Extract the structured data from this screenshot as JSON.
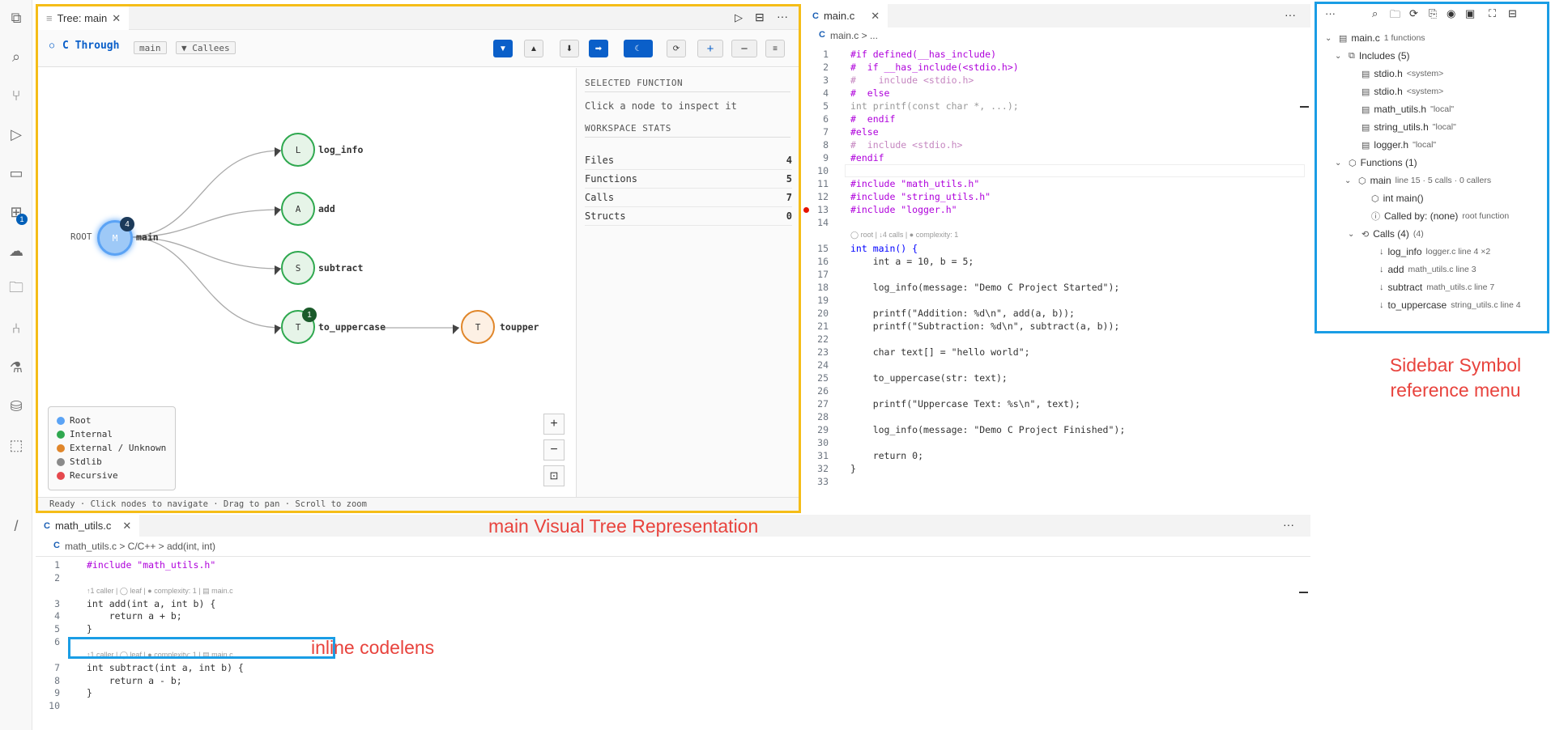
{
  "activity_icons": [
    "files-icon",
    "search-icon",
    "source-control-icon",
    "run-debug-icon",
    "remote-explorer-icon",
    "extensions-icon",
    "chat-icon",
    "folder-icon",
    "git-graph-icon",
    "testing-icon",
    "database-icon",
    "cube-icon",
    "slash-icon"
  ],
  "extensions_badge": "1",
  "tree_panel": {
    "tab_label": "Tree: main",
    "title": "C Through",
    "chip_main": "main",
    "chip_callees": "▼ Callees",
    "selected_header": "SELECTED FUNCTION",
    "selected_hint": "Click a node to inspect it",
    "stats_header": "WORKSPACE STATS",
    "stats": [
      {
        "label": "Files",
        "value": "4"
      },
      {
        "label": "Functions",
        "value": "5"
      },
      {
        "label": "Calls",
        "value": "7"
      },
      {
        "label": "Structs",
        "value": "0"
      }
    ],
    "root_label": "ROOT",
    "nodes": [
      {
        "letter": "M",
        "label": "main",
        "kind": "root",
        "badge": "4"
      },
      {
        "letter": "L",
        "label": "log_info",
        "kind": "internal"
      },
      {
        "letter": "A",
        "label": "add",
        "kind": "internal"
      },
      {
        "letter": "S",
        "label": "subtract",
        "kind": "internal"
      },
      {
        "letter": "T",
        "label": "to_uppercase",
        "kind": "internal",
        "badge": "1"
      },
      {
        "letter": "T",
        "label": "toupper",
        "kind": "external"
      }
    ],
    "legend": [
      {
        "label": "Root",
        "color": "#5ba3f5"
      },
      {
        "label": "Internal",
        "color": "#2fa84f"
      },
      {
        "label": "External / Unknown",
        "color": "#e0862a"
      },
      {
        "label": "Stdlib",
        "color": "#8a8a8a"
      },
      {
        "label": "Recursive",
        "color": "#e5484d"
      }
    ],
    "status": "Ready · Click nodes to navigate · Drag to pan · Scroll to zoom"
  },
  "main_editor": {
    "tab_label": "main.c",
    "breadcrumb": "main.c > ...",
    "codelens": "◯ root | ↓4 calls | ● complexity: 1",
    "lines": [
      {
        "n": "1",
        "t": "#if defined(__has_include)",
        "c": "pp"
      },
      {
        "n": "2",
        "t": "#  if __has_include(<stdio.h>)",
        "c": "pp"
      },
      {
        "n": "3",
        "t": "#    include <stdio.h>",
        "c": "cm"
      },
      {
        "n": "4",
        "t": "#  else",
        "c": "pp"
      },
      {
        "n": "5",
        "t": "int printf(const char *, ...);",
        "c": "gray"
      },
      {
        "n": "6",
        "t": "#  endif",
        "c": "pp"
      },
      {
        "n": "7",
        "t": "#else",
        "c": "pp"
      },
      {
        "n": "8",
        "t": "#  include <stdio.h>",
        "c": "cm"
      },
      {
        "n": "9",
        "t": "#endif",
        "c": "pp"
      },
      {
        "n": "10",
        "t": "",
        "c": ""
      },
      {
        "n": "11",
        "t": "#include \"math_utils.h\"",
        "c": "pp"
      },
      {
        "n": "12",
        "t": "#include \"string_utils.h\"",
        "c": "pp"
      },
      {
        "n": "13",
        "t": "#include \"logger.h\"",
        "c": "pp"
      },
      {
        "n": "14",
        "t": "",
        "c": ""
      },
      {
        "n": "15",
        "t": "int main() {",
        "c": "kw"
      },
      {
        "n": "16",
        "t": "    int a = 10, b = 5;",
        "c": ""
      },
      {
        "n": "17",
        "t": "",
        "c": ""
      },
      {
        "n": "18",
        "t": "    log_info(message: \"Demo C Project Started\");",
        "c": ""
      },
      {
        "n": "19",
        "t": "",
        "c": ""
      },
      {
        "n": "20",
        "t": "    printf(\"Addition: %d\\n\", add(a, b));",
        "c": ""
      },
      {
        "n": "21",
        "t": "    printf(\"Subtraction: %d\\n\", subtract(a, b));",
        "c": ""
      },
      {
        "n": "22",
        "t": "",
        "c": ""
      },
      {
        "n": "23",
        "t": "    char text[] = \"hello world\";",
        "c": ""
      },
      {
        "n": "24",
        "t": "",
        "c": ""
      },
      {
        "n": "25",
        "t": "    to_uppercase(str: text);",
        "c": ""
      },
      {
        "n": "26",
        "t": "",
        "c": ""
      },
      {
        "n": "27",
        "t": "    printf(\"Uppercase Text: %s\\n\", text);",
        "c": ""
      },
      {
        "n": "28",
        "t": "",
        "c": ""
      },
      {
        "n": "29",
        "t": "    log_info(message: \"Demo C Project Finished\");",
        "c": ""
      },
      {
        "n": "30",
        "t": "",
        "c": ""
      },
      {
        "n": "31",
        "t": "    return 0;",
        "c": ""
      },
      {
        "n": "32",
        "t": "}",
        "c": ""
      },
      {
        "n": "33",
        "t": "",
        "c": ""
      }
    ]
  },
  "bottom_editor": {
    "tab_label": "math_utils.c",
    "breadcrumb": "math_utils.c > C/C++ > add(int, int)",
    "codelens1": "↑1 caller | ◯ leaf | ● complexity: 1 | ▤ main.c",
    "codelens2": "↑1 caller | ◯ leaf | ● complexity: 1 | ▤ main.c",
    "lines": [
      {
        "n": "1",
        "t": "#include \"math_utils.h\""
      },
      {
        "n": "2",
        "t": ""
      },
      {
        "n": "3",
        "t": "int add(int a, int b) {"
      },
      {
        "n": "4",
        "t": "    return a + b;"
      },
      {
        "n": "5",
        "t": "}"
      },
      {
        "n": "6",
        "t": ""
      },
      {
        "n": "7",
        "t": "int subtract(int a, int b) {"
      },
      {
        "n": "8",
        "t": "    return a - b;"
      },
      {
        "n": "9",
        "t": "}"
      },
      {
        "n": "10",
        "t": ""
      }
    ]
  },
  "sidebar": {
    "file": "main.c",
    "file_desc": "1 functions",
    "includes_label": "Includes (5)",
    "includes": [
      {
        "name": "stdio.h",
        "desc": "<system>"
      },
      {
        "name": "stdio.h",
        "desc": "<system>"
      },
      {
        "name": "math_utils.h",
        "desc": "\"local\""
      },
      {
        "name": "string_utils.h",
        "desc": "\"local\""
      },
      {
        "name": "logger.h",
        "desc": "\"local\""
      }
    ],
    "functions_label": "Functions (1)",
    "main_name": "main",
    "main_desc": "line 15 · 5 calls · 0 callers",
    "signature": "int main()",
    "called_by": "Called by: (none)",
    "called_by_desc": "root function",
    "calls_label": "Calls (4)",
    "calls_desc": "(4)",
    "calls": [
      {
        "name": "log_info",
        "desc": "logger.c line 4 ×2"
      },
      {
        "name": "add",
        "desc": "math_utils.c line 3"
      },
      {
        "name": "subtract",
        "desc": "math_utils.c line 7"
      },
      {
        "name": "to_uppercase",
        "desc": "string_utils.c line 4"
      }
    ]
  },
  "annotations": {
    "sidebar": "Sidebar Symbol\nreference menu",
    "tree": "main Visual Tree Representation",
    "codelens": "inline codelens"
  }
}
